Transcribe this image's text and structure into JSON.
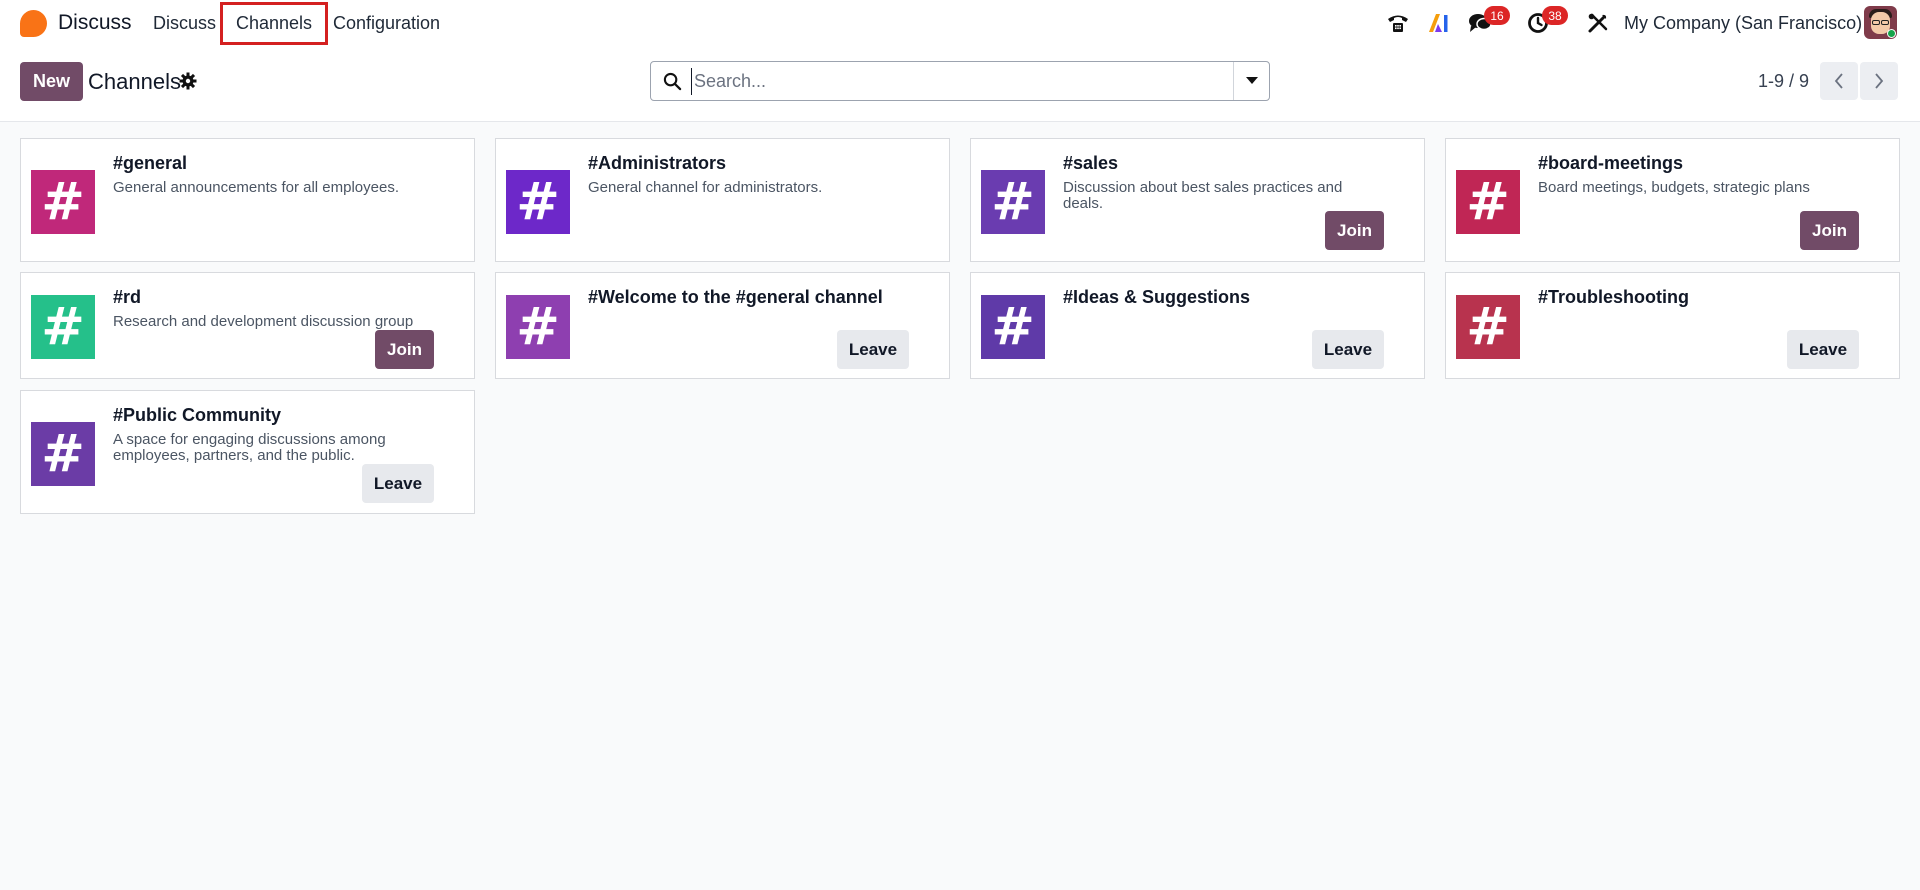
{
  "navbar": {
    "app_name": "Discuss",
    "menu": {
      "discuss": "Discuss",
      "channels": "Channels",
      "configuration": "Configuration"
    },
    "messages_badge": "16",
    "activities_badge": "38",
    "company": "My Company (San Francisco)",
    "icons": [
      "phone-icon",
      "ai-icon",
      "messages-icon",
      "activities-icon",
      "tools-icon"
    ]
  },
  "control_panel": {
    "new_label": "New",
    "title": "Channels",
    "search_placeholder": "Search...",
    "pager_value": "1-9 / 9"
  },
  "colors": {
    "brand": "#714b67",
    "badge": "#dc2626",
    "highlight": "#d42020"
  },
  "channels": [
    {
      "name": "#general",
      "description": "General announcements for all employees.",
      "action": "",
      "color": "#c0287a"
    },
    {
      "name": "#Administrators",
      "description": "General channel for administrators.",
      "action": "",
      "color": "#6d28c9"
    },
    {
      "name": "#sales",
      "description": "Discussion about best sales practices and deals.",
      "action": "Join",
      "color": "#6a3cb0"
    },
    {
      "name": "#board-meetings",
      "description": "Board meetings, budgets, strategic plans",
      "action": "Join",
      "color": "#c02655"
    },
    {
      "name": "#rd",
      "description": "Research and development discussion group",
      "action": "Join",
      "color": "#25c08a"
    },
    {
      "name": "#Welcome to the #general channel",
      "description": "",
      "action": "Leave",
      "color": "#8e3fb0"
    },
    {
      "name": "#Ideas & Suggestions",
      "description": "",
      "action": "Leave",
      "color": "#5f3aa8"
    },
    {
      "name": "#Troubleshooting",
      "description": "",
      "action": "Leave",
      "color": "#b8334e"
    },
    {
      "name": "#Public Community",
      "description": "A space for engaging discussions among employees, partners, and the public.",
      "action": "Leave",
      "color": "#6b3ca6"
    }
  ]
}
